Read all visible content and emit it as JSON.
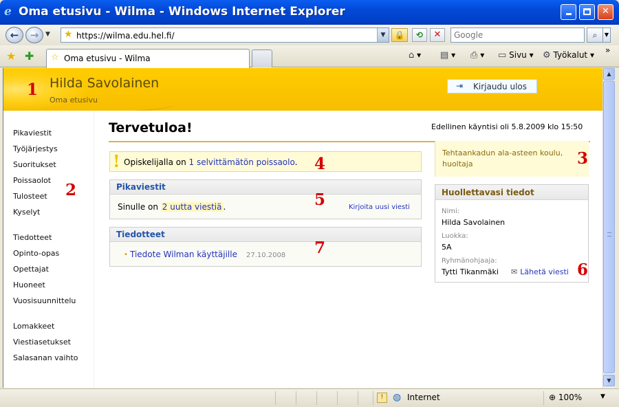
{
  "window": {
    "title": "Oma etusivu - Wilma - Windows Internet Explorer",
    "minimize": "_",
    "close": "✕"
  },
  "browser": {
    "url": "https://wilma.edu.hel.fi/",
    "search_placeholder": "Google",
    "tab_label": "Oma etusivu - Wilma",
    "tools": {
      "page": "Sivu",
      "tools": "Työkalut"
    },
    "status_zone": "Internet",
    "zoom": "100%"
  },
  "header": {
    "user_name": "Hilda Savolainen",
    "subtitle": "Oma etusivu",
    "logout_label": "Kirjaudu ulos"
  },
  "sidebar": {
    "group1": [
      "Pikaviestit",
      "Työjärjestys",
      "Suoritukset",
      "Poissaolot",
      "Tulosteet",
      "Kyselyt"
    ],
    "group2": [
      "Tiedotteet",
      "Opinto-opas",
      "Opettajat",
      "Huoneet",
      "Vuosisuunnittelu"
    ],
    "group3": [
      "Lomakkeet",
      "Viestiasetukset",
      "Salasanan vaihto"
    ]
  },
  "main": {
    "welcome": "Tervetuloa!",
    "last_visit": "Edellinen käyntisi oli 5.8.2009 klo 15:50",
    "alert": {
      "prefix": "Opiskelijalla on ",
      "link": "1 selvittämätön poissaolo",
      "suffix": "."
    },
    "messages": {
      "title": "Pikaviestit",
      "prefix": "Sinulle on ",
      "link": "2 uutta viestiä",
      "suffix": ".",
      "write_new": "Kirjoita uusi viesti"
    },
    "bulletins": {
      "title": "Tiedotteet",
      "items": [
        {
          "title": "Tiedote Wilman käyttäjille",
          "date": "27.10.2008"
        }
      ]
    }
  },
  "right": {
    "school": "Tehtaankadun ala-asteen koulu, huoltaja",
    "guardian": {
      "title": "Huollettavasi tiedot",
      "name_label": "Nimi:",
      "name": "Hilda Savolainen",
      "class_label": "Luokka:",
      "class": "5A",
      "supervisor_label": "Ryhmänohjaaja:",
      "supervisor": "Tytti Tikanmäki",
      "send_message": "Lähetä viesti"
    }
  },
  "annotations": [
    "1",
    "2",
    "3",
    "4",
    "5",
    "6",
    "7"
  ],
  "colors": {
    "header_yellow": "#ffcc00",
    "link_blue": "#2233bb",
    "marker_red": "#d40000",
    "alert_bg": "#fffbd6"
  }
}
